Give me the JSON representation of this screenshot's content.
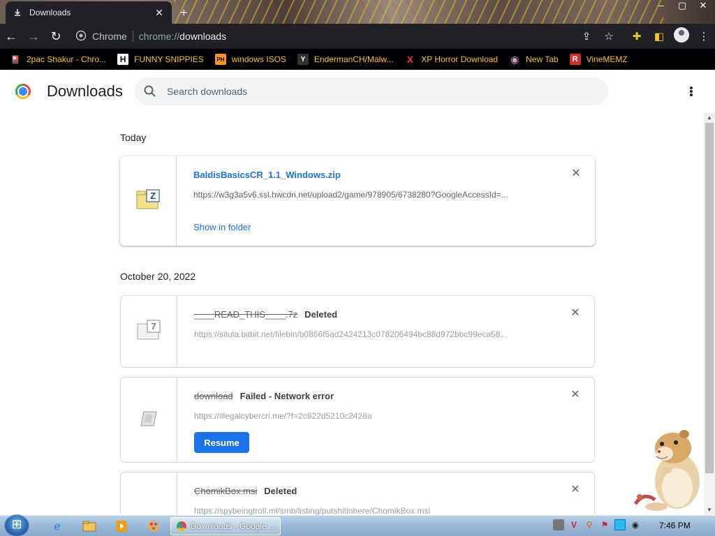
{
  "window": {
    "tab_title": "Downloads",
    "tab_close": "✕",
    "new_tab": "+",
    "minimize": "–",
    "maximize": "▢",
    "close": "✕"
  },
  "toolbar": {
    "back": "←",
    "forward": "→",
    "reload": "↻",
    "site_label": "Chrome",
    "url_scheme": "chrome://",
    "url_host": "downloads",
    "share": "⇪",
    "bookmark_star": "☆",
    "extensions": "✚",
    "sidepanel": "◧",
    "menu": "⋮"
  },
  "bookmarks": [
    {
      "label": "2pac Shakur - Chro...",
      "icon": "2pac-favicon",
      "glyph": "🎴"
    },
    {
      "label": "FUNNY SNIPPIES",
      "icon": "h-favicon",
      "glyph": "H"
    },
    {
      "label": "windows ISOS",
      "icon": "ph-favicon",
      "glyph": "PH"
    },
    {
      "label": "EndermanCH/Malw...",
      "icon": "github-favicon",
      "glyph": "Y"
    },
    {
      "label": "XP Horror Download",
      "icon": "x-favicon",
      "glyph": "X"
    },
    {
      "label": "New Tab",
      "icon": "globe-favicon",
      "glyph": "◉"
    },
    {
      "label": "VineMEMZ",
      "icon": "r-favicon",
      "glyph": "R"
    }
  ],
  "page": {
    "title": "Downloads",
    "search_placeholder": "Search downloads",
    "sections": [
      {
        "date": "Today",
        "items": [
          {
            "filename": "BaldisBasicsCR_1.1_Windows.zip",
            "url": "https://w3g3a5v6.ssl.hwcdn.net/upload2/game/978905/6738280?GoogleAccessId=...",
            "action": "Show in folder",
            "remove": "✕"
          }
        ]
      },
      {
        "date": "October 20, 2022",
        "items": [
          {
            "filename": "____READ_THIS____.7z",
            "status": "Deleted",
            "url": "https://situla.bitbit.net/filebin/b0866f5ad2424213c078206494bc88d972bbc99eca58...",
            "remove": "✕"
          },
          {
            "filename": "download",
            "status": "Failed - Network error",
            "url": "https://illegalcybercri.me/?f=2c822d5210c2428a",
            "action": "Resume",
            "remove": "✕"
          },
          {
            "filename": "ChomikBox.msi",
            "status": "Deleted",
            "url": "https://spybeingtroll.ml/smb/listing/putshitinhere/ChomikBox.msi",
            "remove": "✕"
          }
        ]
      }
    ]
  },
  "taskbar": {
    "task_label": "Downloads - Google ...",
    "clock": "7:46 PM"
  }
}
